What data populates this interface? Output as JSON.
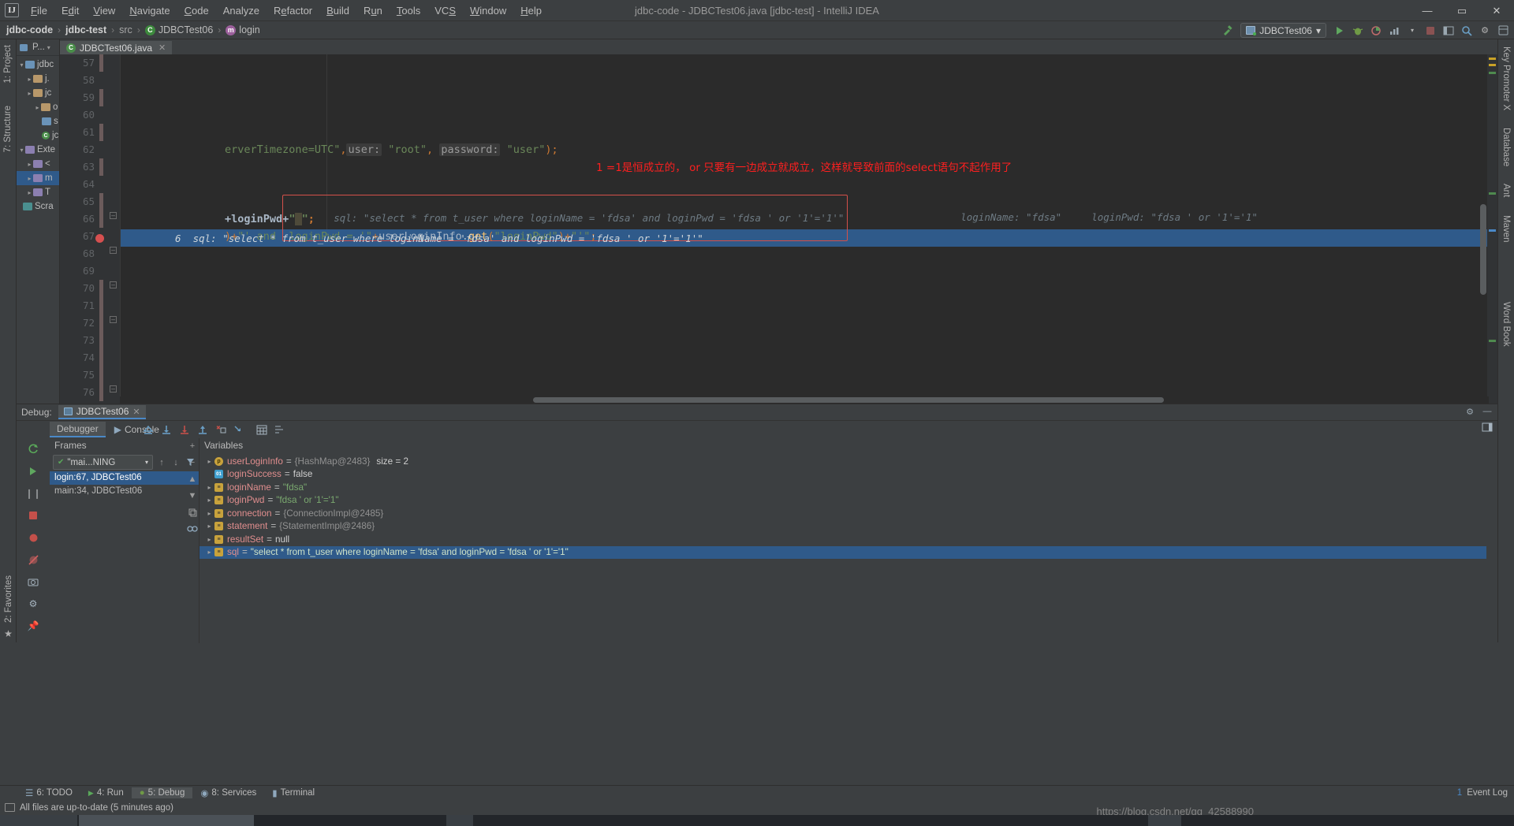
{
  "window": {
    "title": "jdbc-code - JDBCTest06.java [jdbc-test] - IntelliJ IDEA",
    "logo": "IJ",
    "minimize": "—",
    "maximize": "▭",
    "close": "✕"
  },
  "menu": [
    {
      "label": "File"
    },
    {
      "label": "Edit"
    },
    {
      "label": "View"
    },
    {
      "label": "Navigate"
    },
    {
      "label": "Code"
    },
    {
      "label": "Analyze"
    },
    {
      "label": "Refactor"
    },
    {
      "label": "Build"
    },
    {
      "label": "Run"
    },
    {
      "label": "Tools"
    },
    {
      "label": "VCS"
    },
    {
      "label": "Window"
    },
    {
      "label": "Help"
    }
  ],
  "breadcrumb": {
    "items": [
      {
        "label": "jdbc-code",
        "style": "strong"
      },
      {
        "label": "jdbc-test",
        "style": "strong"
      },
      {
        "label": "src",
        "style": "dim"
      },
      {
        "label": "JDBCTest06",
        "icon": "class-icon"
      },
      {
        "label": "login",
        "icon": "method-icon"
      }
    ],
    "separator": "›"
  },
  "toolbar": {
    "run_config": "JDBCTest06",
    "dropdown_caret": "▾",
    "run_label": "run-button",
    "debug_label": "debug-button",
    "stop_label": "stop-button"
  },
  "left_strip": {
    "project": "1: Project",
    "structure": "7: Structure",
    "favorites": "2: Favorites"
  },
  "right_strip": {
    "notifications": "Key Promoter X",
    "database": "Database",
    "ant": "Ant",
    "maven": "Maven",
    "word_book": "Word Book"
  },
  "project_panel": {
    "header": "P...",
    "tree": [
      {
        "label": "jdbc",
        "type": "module",
        "depth": 0,
        "arrow": "▾"
      },
      {
        "label": "j.",
        "type": "folder",
        "depth": 1,
        "arrow": "▸"
      },
      {
        "label": "jc",
        "type": "folder",
        "depth": 1,
        "arrow": "▸"
      },
      {
        "label": "o",
        "type": "folder",
        "depth": 1,
        "arrow": "▸"
      },
      {
        "label": "s",
        "type": "folder-blue",
        "depth": 2,
        "arrow": ""
      },
      {
        "label": "jc",
        "type": "file",
        "depth": 2,
        "arrow": ""
      },
      {
        "label": "Exte",
        "type": "lib",
        "depth": 0,
        "arrow": "▾"
      },
      {
        "label": "<",
        "type": "lib",
        "depth": 1,
        "arrow": "▸"
      },
      {
        "label": "m",
        "type": "lib",
        "depth": 1,
        "arrow": "▸",
        "selected": true
      },
      {
        "label": "T",
        "type": "lib",
        "depth": 1,
        "arrow": "▸"
      },
      {
        "label": "Scra",
        "type": "scratch",
        "depth": 0,
        "arrow": ""
      }
    ]
  },
  "editor": {
    "tab": {
      "label": "JDBCTest06.java",
      "close": "✕",
      "icon": "java-class-icon"
    },
    "first_line": 57,
    "lines": [
      {
        "num": 57,
        "modified": true,
        "code": ""
      },
      {
        "num": 58,
        "modified": false,
        "code": ""
      },
      {
        "num": 59,
        "modified": true,
        "code": ""
      },
      {
        "num": 60,
        "modified": false,
        "code": ""
      },
      {
        "num": 61,
        "modified": true,
        "code": "erverTimezone=UTC\", user: \"root\", password: \"user\");"
      },
      {
        "num": 62,
        "modified": false,
        "code": ""
      },
      {
        "num": 63,
        "modified": true,
        "code": ""
      },
      {
        "num": 64,
        "modified": false,
        "code": ""
      },
      {
        "num": 65,
        "modified": true,
        "code": "+loginPwd+\"'\";"
      },
      {
        "num": 66,
        "modified": false,
        "code": ")+\"' and  loginPwd = '\"+userLoginInfo.get(\"loginPwd\")+\"'\";"
      },
      {
        "num": 67,
        "modified": false,
        "code": "6  sql: \"select * from t_user where loginName = 'fdsa' and loginPwd = 'fdsa ' or '1'='1'\"",
        "executing": true,
        "breakpoint": true
      },
      {
        "num": 68,
        "modified": false,
        "code": ""
      },
      {
        "num": 69,
        "modified": false,
        "code": "",
        "fold": true
      },
      {
        "num": 70,
        "modified": false,
        "code": ""
      },
      {
        "num": 71,
        "modified": false,
        "code": ""
      },
      {
        "num": 72,
        "modified": false,
        "code": "",
        "fold": true
      },
      {
        "num": 73,
        "modified": false,
        "code": ""
      },
      {
        "num": 74,
        "modified": false,
        "code": "",
        "fold": true
      },
      {
        "num": 75,
        "modified": false,
        "code": ""
      },
      {
        "num": 76,
        "modified": false,
        "code": "",
        "fold": true
      }
    ],
    "annotation_red": "1 =1是恒成立的， or  只要有一边成立就成立，这样就导致前面的select语句不起作用了",
    "inline_hint_label": "sql:",
    "inline_hint_value": "\"select * from t_user where loginName = 'fdsa' and loginPwd = 'fdsa ' or '1'='1'\"",
    "inline_hint_tail_1_label": "loginName:",
    "inline_hint_tail_1_value": "\"fdsa\"",
    "inline_hint_tail_2_label": "loginPwd:",
    "inline_hint_tail_2_value": "\"fdsa ' or '1'='1\"",
    "exec_line_text": "6  sql: \"select * from t_user where loginName = 'fdsa' and loginPwd = 'fdsa ' or '1'='1'\""
  },
  "debug": {
    "label": "Debug:",
    "session_tab": "JDBCTest06",
    "session_close": "✕",
    "settings_icon": "gear-icon",
    "minimize_icon": "minimize-icon",
    "layout_icon": "layout-icon",
    "subtabs": [
      {
        "label": "Debugger",
        "active": true
      },
      {
        "label": "Console",
        "active": false
      }
    ],
    "frames": {
      "header": "Frames",
      "thread": "\"mai...NING",
      "thread_caret": "▾",
      "rows": [
        {
          "label": "login:67, JDBCTest06",
          "selected": true
        },
        {
          "label": "main:34, JDBCTest06",
          "selected": false
        }
      ]
    },
    "variables": {
      "header": "Variables",
      "rows": [
        {
          "twisty": "▸",
          "icon": "p",
          "name": "userLoginInfo",
          "eq": "=",
          "value": "{HashMap@2483}",
          "value_kind": "obj",
          "extra": "size = 2",
          "indent": 0
        },
        {
          "twisty": "",
          "icon": "b",
          "name": "loginSuccess",
          "eq": "=",
          "value": "false",
          "value_kind": "plain",
          "extra": "",
          "indent": 1
        },
        {
          "twisty": "▸",
          "icon": "s",
          "name": "loginName",
          "eq": "=",
          "value": "\"fdsa\"",
          "value_kind": "str",
          "extra": "",
          "indent": 0
        },
        {
          "twisty": "▸",
          "icon": "s",
          "name": "loginPwd",
          "eq": "=",
          "value": "\"fdsa ' or '1'='1\"",
          "value_kind": "str",
          "extra": "",
          "indent": 0
        },
        {
          "twisty": "▸",
          "icon": "s",
          "name": "connection",
          "eq": "=",
          "value": "{ConnectionImpl@2485}",
          "value_kind": "obj",
          "extra": "",
          "indent": 0
        },
        {
          "twisty": "▸",
          "icon": "s",
          "name": "statement",
          "eq": "=",
          "value": "{StatementImpl@2486}",
          "value_kind": "obj",
          "extra": "",
          "indent": 0
        },
        {
          "twisty": "▸",
          "icon": "s",
          "name": "resultSet",
          "eq": "=",
          "value": "null",
          "value_kind": "plain",
          "extra": "",
          "indent": 0
        },
        {
          "twisty": "▸",
          "icon": "s",
          "name": "sql",
          "eq": "=",
          "value": "\"select * from t_user where loginName = 'fdsa' and loginPwd = 'fdsa ' or '1'='1\"",
          "value_kind": "str",
          "extra": "",
          "indent": 0,
          "highlight": true
        }
      ]
    }
  },
  "bottom_toolbar": {
    "items": [
      {
        "label": "6: TODO",
        "icon": "todo-icon",
        "active": false
      },
      {
        "label": "4: Run",
        "icon": "run-icon",
        "active": false
      },
      {
        "label": "5: Debug",
        "icon": "debug-icon",
        "active": true
      },
      {
        "label": "8: Services",
        "icon": "services-icon",
        "active": false
      },
      {
        "label": "Terminal",
        "icon": "terminal-icon",
        "active": false
      }
    ],
    "event_log": "Event Log",
    "event_log_count": "1"
  },
  "status_bar": {
    "message": "All files are up-to-date (5 minutes ago)",
    "icon": "file-sync-icon"
  },
  "watermark": "https://blog.csdn.net/qq_42588990",
  "colors": {
    "accent_blue": "#4a88c7",
    "selection_blue": "#2f5a8a",
    "error_red": "#ff1f1f",
    "string_green": "#6a8759",
    "keyword_orange": "#cc7832",
    "bg_editor": "#2b2b2b",
    "bg_chrome": "#3c3f41"
  }
}
